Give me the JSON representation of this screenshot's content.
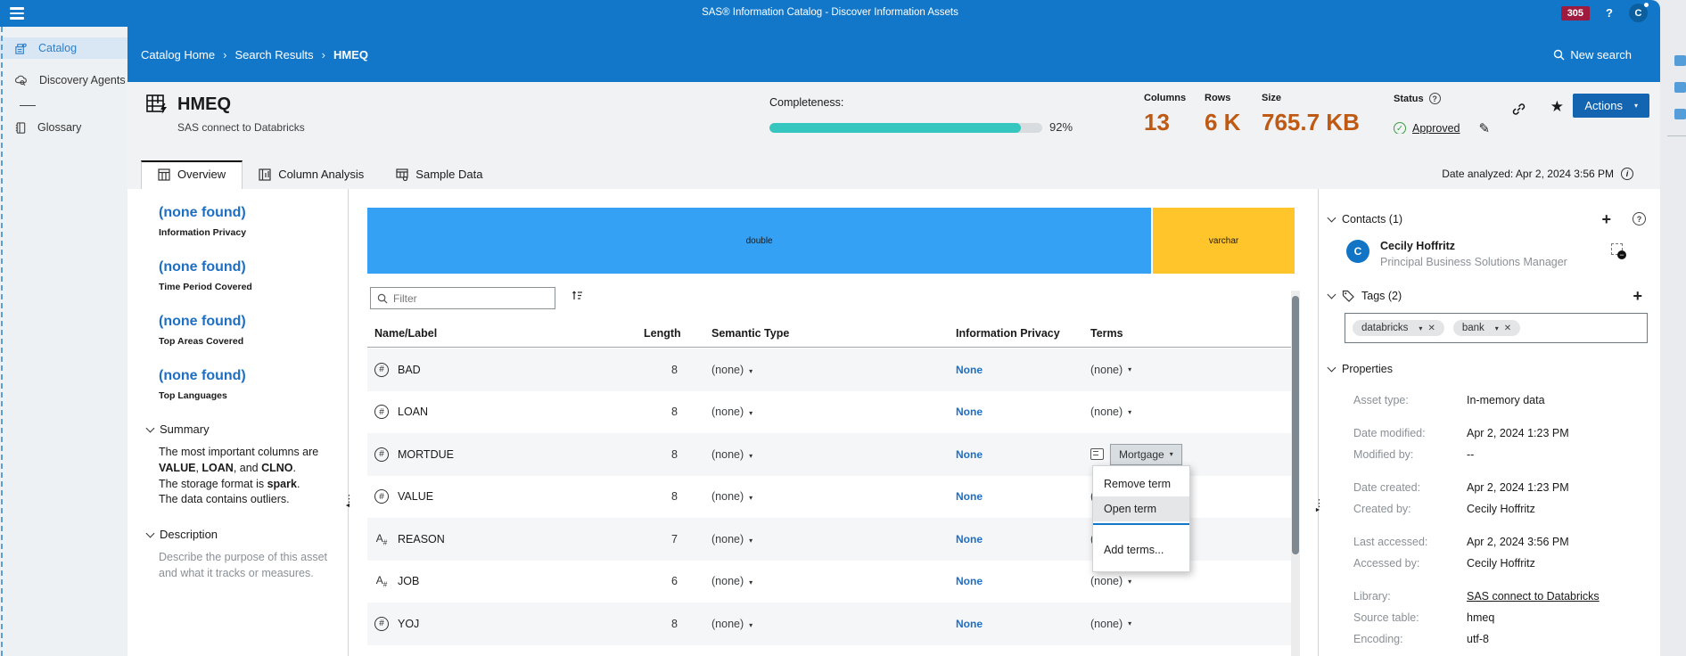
{
  "colors": {
    "appbar_blue": "#1277c9",
    "actions_blue": "#1365b2",
    "badge_red": "#9e1b3f",
    "stat_orange": "#bf5a14",
    "progress_teal": "#35c6bf",
    "link_blue": "#1e6fc2",
    "approved_green": "#3e9b43"
  },
  "topbar": {
    "title": "SAS® Information Catalog - Discover Information Assets",
    "badge": "305",
    "help": "?",
    "avatar_initial": "C"
  },
  "sidebar": {
    "items": [
      {
        "label": "Catalog"
      },
      {
        "label": "Discovery Agents"
      },
      {
        "label": "Glossary"
      }
    ]
  },
  "breadcrumb": {
    "items": [
      "Catalog Home",
      "Search Results",
      "HMEQ"
    ],
    "separator": "›",
    "new_search": "New search"
  },
  "header": {
    "title": "HMEQ",
    "subtitle": "SAS connect to Databricks",
    "completeness_label": "Completeness:",
    "completeness_pct": "92%",
    "completeness_value": 92,
    "stats": [
      {
        "label": "Columns",
        "value": "13"
      },
      {
        "label": "Rows",
        "value": "6 K"
      },
      {
        "label": "Size",
        "value": "765.7 KB"
      }
    ],
    "status_label": "Status",
    "status_value": "Approved",
    "actions_label": "Actions"
  },
  "tabs": {
    "items": [
      {
        "label": "Overview"
      },
      {
        "label": "Column Analysis"
      },
      {
        "label": "Sample Data"
      }
    ],
    "date_analyzed": "Date analyzed: Apr 2, 2024 3:56 PM"
  },
  "left_panel": {
    "facets": [
      {
        "value": "(none found)",
        "label": "Information Privacy"
      },
      {
        "value": "(none found)",
        "label": "Time Period Covered"
      },
      {
        "value": "(none found)",
        "label": "Top Areas Covered"
      },
      {
        "value": "(none found)",
        "label": "Top Languages"
      }
    ],
    "summary": {
      "title": "Summary",
      "l1a": "The most important columns are ",
      "l1b": "VALUE",
      "l1c": ", ",
      "l1d": "LOAN",
      "l1e": ", and ",
      "l1f": "CLNO",
      "l1g": ".",
      "l2a": "The storage format is ",
      "l2b": "spark",
      "l2c": ".",
      "l3": "The data contains outliers."
    },
    "description": {
      "title": "Description",
      "placeholder": "Describe the purpose of this asset and what it tracks or measures."
    }
  },
  "type_bar": {
    "segments": [
      {
        "label": "double",
        "color": "#34a1f5",
        "width_pct": 84.7
      },
      {
        "label": "varchar",
        "color": "#ffc52b",
        "width_pct": 15.3
      }
    ]
  },
  "filter": {
    "placeholder": "Filter"
  },
  "table": {
    "columns": [
      "Name/Label",
      "Length",
      "Semantic Type",
      "Information Privacy",
      "Terms"
    ],
    "rows": [
      {
        "name": "BAD",
        "length": "8",
        "semantic_type": "(none)",
        "privacy": "None",
        "terms": "(none)"
      },
      {
        "name": "LOAN",
        "length": "8",
        "semantic_type": "(none)",
        "privacy": "None",
        "terms": "(none)"
      },
      {
        "name": "MORTDUE",
        "length": "8",
        "semantic_type": "(none)",
        "privacy": "None",
        "terms": "Mortgage"
      },
      {
        "name": "VALUE",
        "length": "8",
        "semantic_type": "(none)",
        "privacy": "None",
        "terms": "(none)"
      },
      {
        "name": "REASON",
        "length": "7",
        "semantic_type": "(none)",
        "privacy": "None",
        "terms": "(none)"
      },
      {
        "name": "JOB",
        "length": "6",
        "semantic_type": "(none)",
        "privacy": "None",
        "terms": "(none)"
      },
      {
        "name": "YOJ",
        "length": "8",
        "semantic_type": "(none)",
        "privacy": "None",
        "terms": "(none)"
      }
    ]
  },
  "term_menu": {
    "items": [
      "Remove term",
      "Open term",
      "Add terms..."
    ],
    "highlighted": "Open term"
  },
  "right_panel": {
    "contacts": {
      "title": "Contacts (1)",
      "person": {
        "initial": "C",
        "name": "Cecily Hoffritz",
        "role": "Principal Business Solutions Manager"
      }
    },
    "tags": {
      "title": "Tags (2)",
      "chips": [
        {
          "label": "databricks"
        },
        {
          "label": "bank"
        }
      ]
    },
    "properties": {
      "title": "Properties",
      "rows": [
        {
          "label": "Asset type:",
          "value": "In-memory data"
        },
        {
          "label": "Date modified:",
          "value": "Apr 2, 2024 1:23 PM"
        },
        {
          "label": "Modified by:",
          "value": "--"
        },
        {
          "label": "Date created:",
          "value": "Apr 2, 2024 1:23 PM"
        },
        {
          "label": "Created by:",
          "value": "Cecily Hoffritz"
        },
        {
          "label": "Last accessed:",
          "value": "Apr 2, 2024 3:56 PM"
        },
        {
          "label": "Accessed by:",
          "value": "Cecily Hoffritz"
        },
        {
          "label": "Library:",
          "value": "SAS connect to Databricks"
        },
        {
          "label": "Source table:",
          "value": "hmeq"
        },
        {
          "label": "Encoding:",
          "value": "utf-8"
        }
      ]
    }
  }
}
